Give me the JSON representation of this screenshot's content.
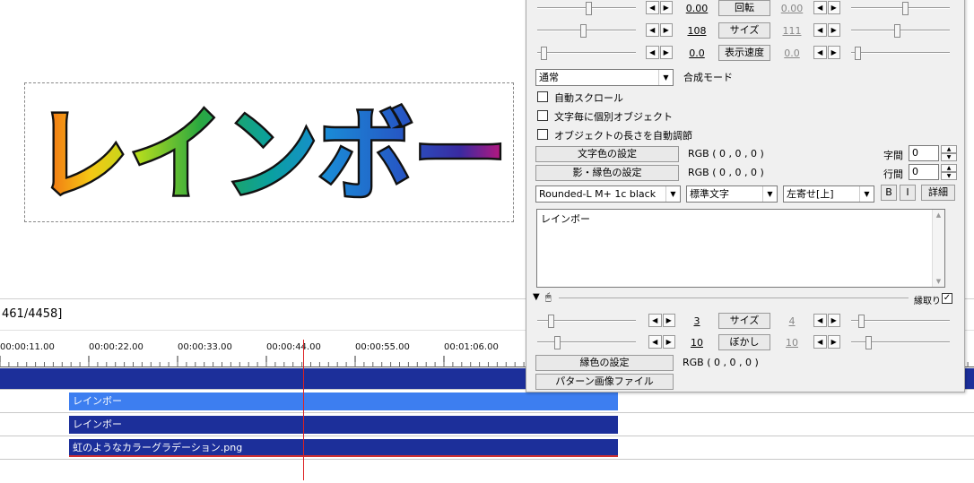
{
  "preview": {
    "text": "レインボー"
  },
  "status": {
    "frame": "461/4458]"
  },
  "timeline": {
    "ticks": [
      "00:00:11.00",
      "00:00:22.00",
      "00:00:33.00",
      "00:00:44.00",
      "00:00:55.00",
      "00:01:06.00"
    ],
    "clips": [
      {
        "label": "レインボー"
      },
      {
        "label": "レインボー"
      },
      {
        "label": "虹のようなカラーグラデーション.png"
      }
    ]
  },
  "panel": {
    "rows": [
      {
        "value": "0.00",
        "button": "回転",
        "value2": "0.00"
      },
      {
        "value": "108",
        "button": "サイズ",
        "value2": "111"
      },
      {
        "value": "0.0",
        "button": "表示速度",
        "value2": "0.0"
      }
    ],
    "blend_mode": "通常",
    "blend_label": "合成モード",
    "checks": [
      "自動スクロール",
      "文字毎に個別オブジェクト",
      "オブジェクトの長さを自動調節"
    ],
    "text_color_btn": "文字色の設定",
    "text_color_val": "RGB ( 0 , 0 , 0 )",
    "shadow_color_btn": "影・縁色の設定",
    "shadow_color_val": "RGB ( 0 , 0 , 0 )",
    "char_spacing_label": "字間",
    "char_spacing_val": "0",
    "line_spacing_label": "行間",
    "line_spacing_val": "0",
    "font": "Rounded-L M+ 1c black",
    "style": "標準文字",
    "align": "左寄せ[上]",
    "bold": "B",
    "italic": "I",
    "detail": "詳細",
    "text_content": "レインボー",
    "filter_label": "縁取り",
    "filter_rows": [
      {
        "value": "3",
        "button": "サイズ",
        "value2": "4"
      },
      {
        "value": "10",
        "button": "ぼかし",
        "value2": "10"
      }
    ],
    "edge_color_btn": "縁色の設定",
    "edge_color_val": "RGB ( 0 , 0 , 0 )",
    "pattern_btn": "パターン画像ファイル"
  }
}
